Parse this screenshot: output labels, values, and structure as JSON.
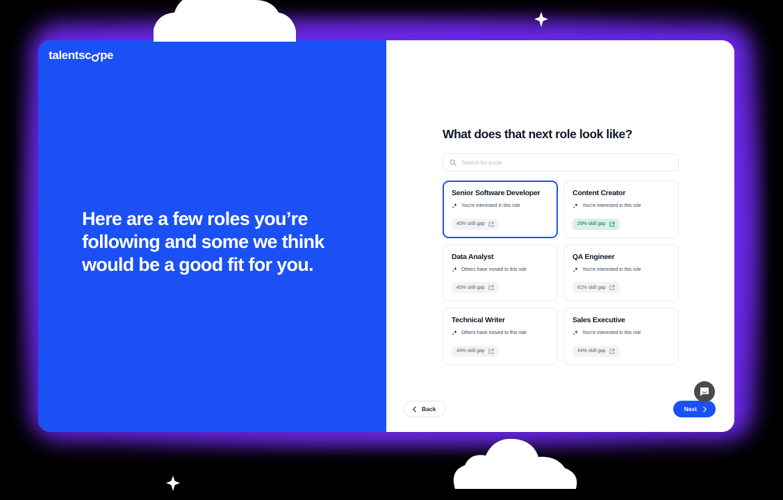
{
  "brand": {
    "logo_text_left": "talentsc",
    "logo_text_right": "pe",
    "logo_full": "talentscope",
    "accent_blue": "#1b50f5",
    "glow_purple": "#6d28f0",
    "page_background": "#000000"
  },
  "left_panel": {
    "heading": "Here are a few roles you’re following and some we think would be a good fit for you."
  },
  "right_panel": {
    "title": "What does that next role look like?",
    "search": {
      "placeholder": "Search for a role",
      "value": "",
      "icon": "search-icon"
    },
    "roles": [
      {
        "name": "Senior Software Developer",
        "note": "You’re interested in this role",
        "note_icon": "sparkle-icon",
        "gap_label": "40% skill gap",
        "gap_percent": 40,
        "gap_style": "neutral",
        "link_icon": "external-link-icon",
        "selected": true
      },
      {
        "name": "Content Creator",
        "note": "You’re interested in this role",
        "note_icon": "sparkle-icon",
        "gap_label": "29% skill gap",
        "gap_percent": 29,
        "gap_style": "green",
        "link_icon": "external-link-icon",
        "selected": false
      },
      {
        "name": "Data Analyst",
        "note": "Others have moved to this role",
        "note_icon": "sparkle-icon",
        "gap_label": "45% skill gap",
        "gap_percent": 45,
        "gap_style": "neutral",
        "link_icon": "external-link-icon",
        "selected": false
      },
      {
        "name": "QA Engineer",
        "note": "You’re interested in this role",
        "note_icon": "sparkle-icon",
        "gap_label": "61% skill gap",
        "gap_percent": 61,
        "gap_style": "neutral",
        "link_icon": "external-link-icon",
        "selected": false
      },
      {
        "name": "Technical Writer",
        "note": "Others have moved to this role",
        "note_icon": "sparkle-icon",
        "gap_label": "49% skill gap",
        "gap_percent": 49,
        "gap_style": "neutral",
        "link_icon": "external-link-icon",
        "selected": false
      },
      {
        "name": "Sales Executive",
        "note": "You’re interested in this role",
        "note_icon": "sparkle-icon",
        "gap_label": "44% skill gap",
        "gap_percent": 44,
        "gap_style": "neutral",
        "link_icon": "external-link-icon",
        "selected": false
      }
    ],
    "footer": {
      "back_label": "Back",
      "back_icon": "chevron-left-icon",
      "next_label": "Next",
      "next_icon": "chevron-right-icon"
    },
    "chat_launcher_icon": "chat-bubble-icon"
  },
  "decorations": {
    "clouds": [
      "cloud-top",
      "cloud-bottom"
    ],
    "sparkles": [
      "sparkle-top-right",
      "sparkle-bottom-left"
    ]
  }
}
